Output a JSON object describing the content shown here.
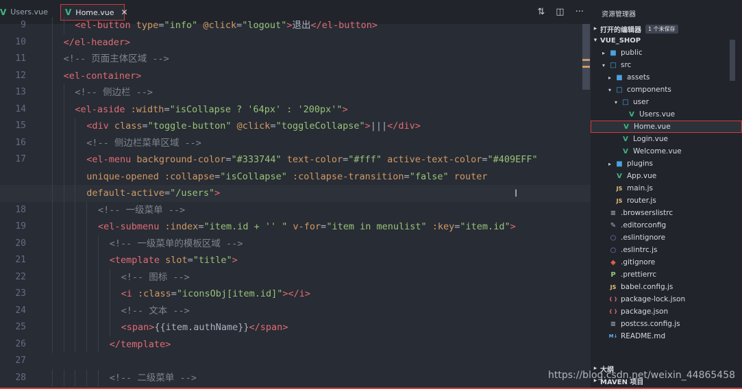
{
  "tabs": [
    {
      "label": "Users.vue",
      "active": false
    },
    {
      "label": "Home.vue",
      "active": true
    }
  ],
  "tab_actions": [
    "compare-icon",
    "split-editor-icon",
    "more-icon"
  ],
  "editor": {
    "lines": [
      {
        "num": "9",
        "indent": 3,
        "parts": [
          [
            "tag",
            "<el-button "
          ],
          [
            "attr",
            "type"
          ],
          [
            "txt",
            "="
          ],
          [
            "str",
            "\"info\""
          ],
          [
            "txt",
            " "
          ],
          [
            "attr",
            "@click"
          ],
          [
            "txt",
            "="
          ],
          [
            "str",
            "\"logout\""
          ],
          [
            "tag",
            ">"
          ],
          [
            "txt",
            "退出"
          ],
          [
            "tag",
            "</el-button>"
          ]
        ]
      },
      {
        "num": "10",
        "indent": 2,
        "parts": [
          [
            "tag",
            "</el-header>"
          ]
        ]
      },
      {
        "num": "11",
        "indent": 2,
        "parts": [
          [
            "cmt",
            "<!-- 页面主体区域 -->"
          ]
        ]
      },
      {
        "num": "12",
        "indent": 2,
        "parts": [
          [
            "tag",
            "<el-container>"
          ]
        ]
      },
      {
        "num": "13",
        "indent": 3,
        "parts": [
          [
            "cmt",
            "<!-- 侧边栏 -->"
          ]
        ]
      },
      {
        "num": "14",
        "indent": 3,
        "parts": [
          [
            "tag",
            "<el-aside "
          ],
          [
            "attr",
            ":width"
          ],
          [
            "txt",
            "="
          ],
          [
            "str",
            "\"isCollapse ? '64px' : '200px'\""
          ],
          [
            "tag",
            ">"
          ]
        ]
      },
      {
        "num": "15",
        "indent": 4,
        "parts": [
          [
            "tag",
            "<div "
          ],
          [
            "attr",
            "class"
          ],
          [
            "txt",
            "="
          ],
          [
            "str",
            "\"toggle-button\""
          ],
          [
            "txt",
            " "
          ],
          [
            "attr",
            "@click"
          ],
          [
            "txt",
            "="
          ],
          [
            "str",
            "\"toggleCollapse\""
          ],
          [
            "tag",
            ">"
          ],
          [
            "txt",
            "|||"
          ],
          [
            "tag",
            "</div>"
          ]
        ]
      },
      {
        "num": "16",
        "indent": 4,
        "parts": [
          [
            "cmt",
            "<!-- 侧边栏菜单区域 -->"
          ]
        ]
      },
      {
        "num": "17",
        "indent": 4,
        "parts": [
          [
            "tag",
            "<el-menu "
          ],
          [
            "attr",
            "background-color"
          ],
          [
            "txt",
            "="
          ],
          [
            "str",
            "\"#333744\""
          ],
          [
            "txt",
            " "
          ],
          [
            "attr",
            "text-color"
          ],
          [
            "txt",
            "="
          ],
          [
            "str",
            "\"#fff\""
          ],
          [
            "txt",
            " "
          ],
          [
            "attr",
            "active-text-color"
          ],
          [
            "txt",
            "="
          ],
          [
            "str",
            "\"#409EFF\""
          ]
        ]
      },
      {
        "num": "",
        "indent": 4,
        "parts": [
          [
            "attr",
            "unique-opened"
          ],
          [
            "txt",
            " "
          ],
          [
            "attr",
            ":collapse"
          ],
          [
            "txt",
            "="
          ],
          [
            "str",
            "\"isCollapse\""
          ],
          [
            "txt",
            " "
          ],
          [
            "attr",
            ":collapse-transition"
          ],
          [
            "txt",
            "="
          ],
          [
            "str",
            "\"false\""
          ],
          [
            "txt",
            " "
          ],
          [
            "attr",
            "router"
          ]
        ]
      },
      {
        "num": "",
        "indent": 4,
        "current": true,
        "parts": [
          [
            "attr",
            "default-active"
          ],
          [
            "txt",
            "="
          ],
          [
            "str",
            "\"/users\""
          ],
          [
            "tag",
            ">"
          ]
        ]
      },
      {
        "num": "18",
        "indent": 5,
        "parts": [
          [
            "cmt",
            "<!-- 一级菜单 -->"
          ]
        ]
      },
      {
        "num": "19",
        "indent": 5,
        "parts": [
          [
            "tag",
            "<el-submenu "
          ],
          [
            "attr",
            ":index"
          ],
          [
            "txt",
            "="
          ],
          [
            "str",
            "\"item.id + '' \""
          ],
          [
            "txt",
            " "
          ],
          [
            "attr",
            "v-for"
          ],
          [
            "txt",
            "="
          ],
          [
            "str",
            "\"item in menulist\""
          ],
          [
            "txt",
            " "
          ],
          [
            "attr",
            ":key"
          ],
          [
            "txt",
            "="
          ],
          [
            "str",
            "\"item.id\""
          ],
          [
            "tag",
            ">"
          ]
        ]
      },
      {
        "num": "20",
        "indent": 6,
        "parts": [
          [
            "cmt",
            "<!-- 一级菜单的模板区域 -->"
          ]
        ]
      },
      {
        "num": "21",
        "indent": 6,
        "parts": [
          [
            "tag",
            "<template "
          ],
          [
            "attr",
            "slot"
          ],
          [
            "txt",
            "="
          ],
          [
            "str",
            "\"title\""
          ],
          [
            "tag",
            ">"
          ]
        ]
      },
      {
        "num": "22",
        "indent": 7,
        "parts": [
          [
            "cmt",
            "<!-- 图标 -->"
          ]
        ]
      },
      {
        "num": "23",
        "indent": 7,
        "parts": [
          [
            "tag",
            "<i "
          ],
          [
            "attr",
            ":class"
          ],
          [
            "txt",
            "="
          ],
          [
            "str",
            "\"iconsObj[item.id]\""
          ],
          [
            "tag",
            "></i>"
          ]
        ]
      },
      {
        "num": "24",
        "indent": 7,
        "parts": [
          [
            "cmt",
            "<!-- 文本 -->"
          ]
        ]
      },
      {
        "num": "25",
        "indent": 7,
        "parts": [
          [
            "tag",
            "<span>"
          ],
          [
            "txt",
            "{{item.authName}}"
          ],
          [
            "tag",
            "</span>"
          ]
        ]
      },
      {
        "num": "26",
        "indent": 6,
        "parts": [
          [
            "tag",
            "</template>"
          ]
        ]
      },
      {
        "num": "27",
        "indent": 0,
        "parts": []
      },
      {
        "num": "28",
        "indent": 6,
        "parts": [
          [
            "cmt",
            "<!-- 二级菜单 -->"
          ]
        ]
      }
    ]
  },
  "explorer": {
    "title": "资源管理器",
    "open_editors_label": "打开的编辑器",
    "unsaved_badge": "1 个未保存",
    "project_label": "VUE_SHOP",
    "items": [
      {
        "label": "public",
        "icon": "folder-icon",
        "depth": 1,
        "twisty": "▸"
      },
      {
        "label": "src",
        "icon": "folder-open-icon",
        "depth": 1,
        "twisty": "▾"
      },
      {
        "label": "assets",
        "icon": "folder-icon",
        "depth": 2,
        "twisty": "▸"
      },
      {
        "label": "components",
        "icon": "folder-open-icon",
        "depth": 2,
        "twisty": "▾"
      },
      {
        "label": "user",
        "icon": "folder-open-icon",
        "depth": 3,
        "twisty": "▾"
      },
      {
        "label": "Users.vue",
        "icon": "vue-file-icon",
        "depth": 4,
        "twisty": ""
      },
      {
        "label": "Home.vue",
        "icon": "vue-file-icon",
        "depth": 3,
        "twisty": "",
        "selected": true
      },
      {
        "label": "Login.vue",
        "icon": "vue-file-icon",
        "depth": 3,
        "twisty": ""
      },
      {
        "label": "Welcome.vue",
        "icon": "vue-file-icon",
        "depth": 3,
        "twisty": ""
      },
      {
        "label": "plugins",
        "icon": "folder-icon",
        "depth": 2,
        "twisty": "▸"
      },
      {
        "label": "App.vue",
        "icon": "vue-file-icon",
        "depth": 2,
        "twisty": ""
      },
      {
        "label": "main.js",
        "icon": "js-file-icon",
        "depth": 2,
        "twisty": ""
      },
      {
        "label": "router.js",
        "icon": "js-file-icon",
        "depth": 2,
        "twisty": ""
      },
      {
        "label": ".browserslistrc",
        "icon": "config-file-icon",
        "depth": 1,
        "twisty": ""
      },
      {
        "label": ".editorconfig",
        "icon": "editorconfig-icon",
        "depth": 1,
        "twisty": ""
      },
      {
        "label": ".eslintignore",
        "icon": "eslint-icon",
        "depth": 1,
        "twisty": ""
      },
      {
        "label": ".eslintrc.js",
        "icon": "eslint-icon",
        "depth": 1,
        "twisty": ""
      },
      {
        "label": ".gitignore",
        "icon": "git-icon",
        "depth": 1,
        "twisty": ""
      },
      {
        "label": ".prettierrc",
        "icon": "prettier-icon",
        "depth": 1,
        "twisty": ""
      },
      {
        "label": "babel.config.js",
        "icon": "babel-file-icon",
        "depth": 1,
        "twisty": ""
      },
      {
        "label": "package-lock.json",
        "icon": "json-file-icon",
        "depth": 1,
        "twisty": ""
      },
      {
        "label": "package.json",
        "icon": "json-file-icon",
        "depth": 1,
        "twisty": ""
      },
      {
        "label": "postcss.config.js",
        "icon": "config-file-icon",
        "depth": 1,
        "twisty": ""
      },
      {
        "label": "README.md",
        "icon": "markdown-file-icon",
        "depth": 1,
        "twisty": ""
      }
    ],
    "outline_label": "大纲",
    "maven_label": "MAVEN 项目"
  },
  "watermark": "https://blog.csdn.net/weixin_44865458",
  "colors": {
    "accent_red": "#d23c3c",
    "vue_green": "#41b883",
    "background": "#282c34",
    "sidebar": "#21252b"
  }
}
